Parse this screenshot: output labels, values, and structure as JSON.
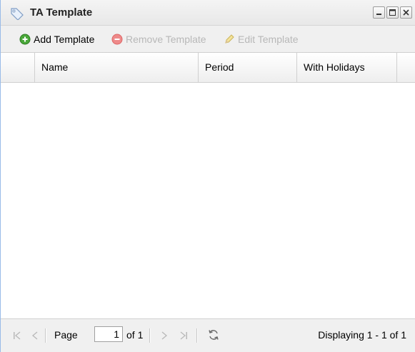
{
  "window": {
    "title": "TA Template",
    "title_icon": "tag-icon",
    "tools": [
      "minimize-icon",
      "maximize-icon",
      "close-icon"
    ]
  },
  "toolbar": {
    "add_label": "Add Template",
    "remove_label": "Remove Template",
    "edit_label": "Edit Template"
  },
  "grid": {
    "columns": [
      "Name",
      "Period",
      "With Holidays"
    ],
    "rows": []
  },
  "pager": {
    "page_label": "Page",
    "page_value": "1",
    "of_label": "of 1",
    "status": "Displaying 1 - 1 of 1"
  },
  "colors": {
    "add_green": "#3a9a2a",
    "remove_red": "#e05050",
    "disabled_text": "#b8b8b8"
  }
}
